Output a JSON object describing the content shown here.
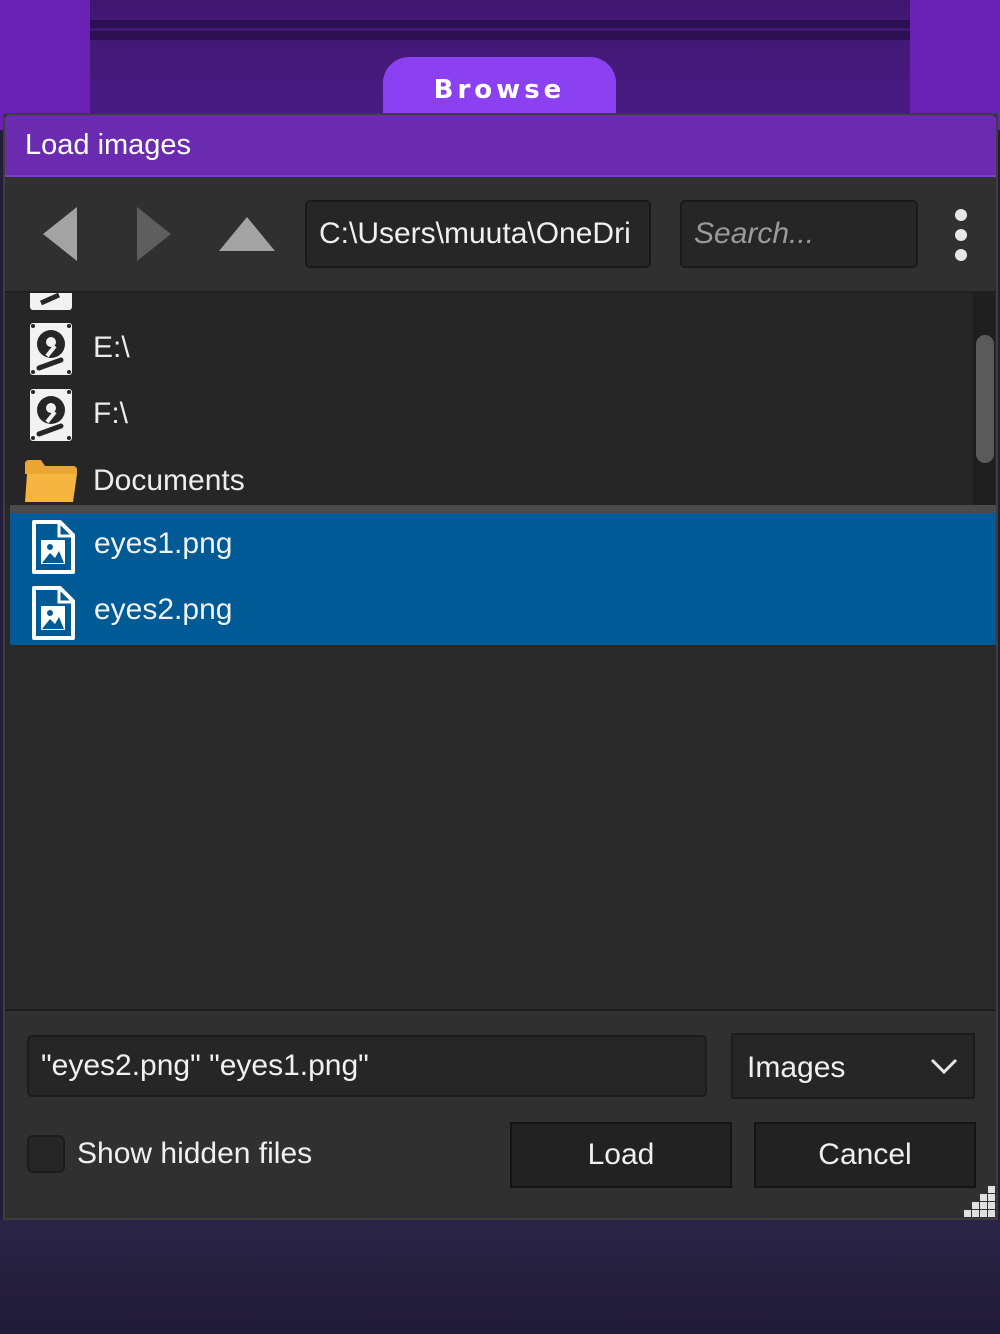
{
  "browse_button": {
    "label": "Browse"
  },
  "dialog": {
    "title": "Load images",
    "toolbar": {
      "back_icon": "left-triangle",
      "forward_icon": "right-triangle",
      "up_icon": "up-triangle",
      "path": "C:\\Users\\muuta\\OneDri",
      "search_placeholder": "Search...",
      "menu_icon": "vertical-ellipsis"
    },
    "file_list": {
      "drives": [
        {
          "label": "E:\\",
          "icon": "hard-drive-icon"
        },
        {
          "label": "F:\\",
          "icon": "hard-drive-icon"
        },
        {
          "label": "Documents",
          "icon": "folder-icon"
        }
      ],
      "files": [
        {
          "label": "eyes1.png",
          "icon": "image-file-icon",
          "selected": true
        },
        {
          "label": "eyes2.png",
          "icon": "image-file-icon",
          "selected": true
        }
      ]
    },
    "footer": {
      "filename_value": "\"eyes2.png\" \"eyes1.png\"",
      "filter_value": "Images",
      "show_hidden_label": "Show hidden files",
      "show_hidden_checked": false,
      "load_label": "Load",
      "cancel_label": "Cancel"
    }
  },
  "colors": {
    "accent": "#8b40f2",
    "titlebar": "#6a2bb0",
    "selection": "#005a96",
    "folder": "#f6b440"
  }
}
